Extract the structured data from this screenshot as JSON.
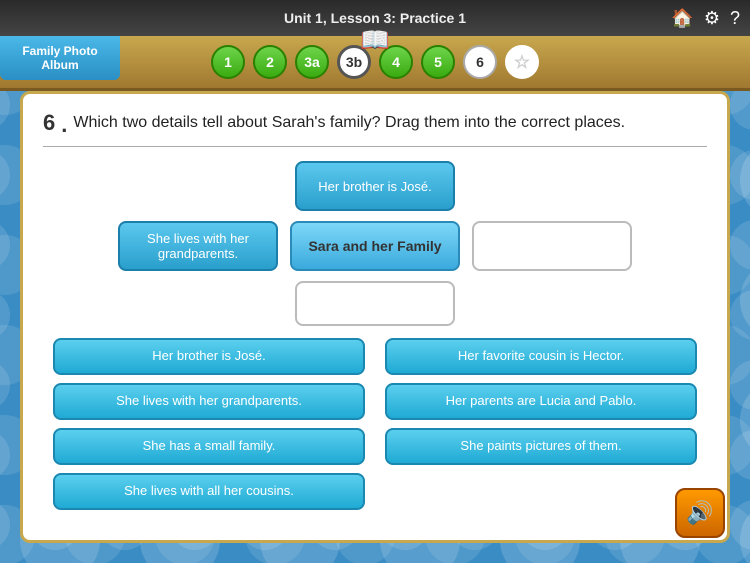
{
  "topBar": {
    "title": "Unit 1, Lesson 3: Practice 1",
    "icons": [
      "🏠",
      "⚙",
      "?"
    ]
  },
  "sidebar": {
    "label": "Family Photo Album"
  },
  "nav": {
    "buttons": [
      {
        "label": "1",
        "style": "green"
      },
      {
        "label": "2",
        "style": "green"
      },
      {
        "label": "3a",
        "style": "green"
      },
      {
        "label": "3b",
        "style": "active"
      },
      {
        "label": "4",
        "style": "green"
      },
      {
        "label": "5",
        "style": "green"
      },
      {
        "label": "6",
        "style": "white-outline"
      },
      {
        "label": "☆",
        "style": "star"
      }
    ]
  },
  "question": {
    "number": "6",
    "text": "Which two details tell about Sarah's family? Drag them into the correct places."
  },
  "dropZones": {
    "row1center": {
      "text": "Her brother is José.",
      "style": "filled-blue"
    },
    "row2left": {
      "text": "She lives with her grandparents.",
      "style": "filled-blue"
    },
    "row2middle": {
      "text": "Sara and her Family",
      "style": "label-tile"
    },
    "row2right": {
      "text": "",
      "style": "empty"
    },
    "row3center": {
      "text": "",
      "style": "empty"
    }
  },
  "options": [
    {
      "id": "opt1",
      "text": "Her brother is José."
    },
    {
      "id": "opt2",
      "text": "Her favorite cousin is Hector."
    },
    {
      "id": "opt3",
      "text": "She lives with her grandparents."
    },
    {
      "id": "opt4",
      "text": "Her parents are Lucia and Pablo."
    },
    {
      "id": "opt5",
      "text": "She has a small family."
    },
    {
      "id": "opt6",
      "text": "She paints pictures of them."
    },
    {
      "id": "opt7",
      "text": "She lives with all her cousins."
    }
  ],
  "speaker": {
    "icon": "🔊"
  }
}
